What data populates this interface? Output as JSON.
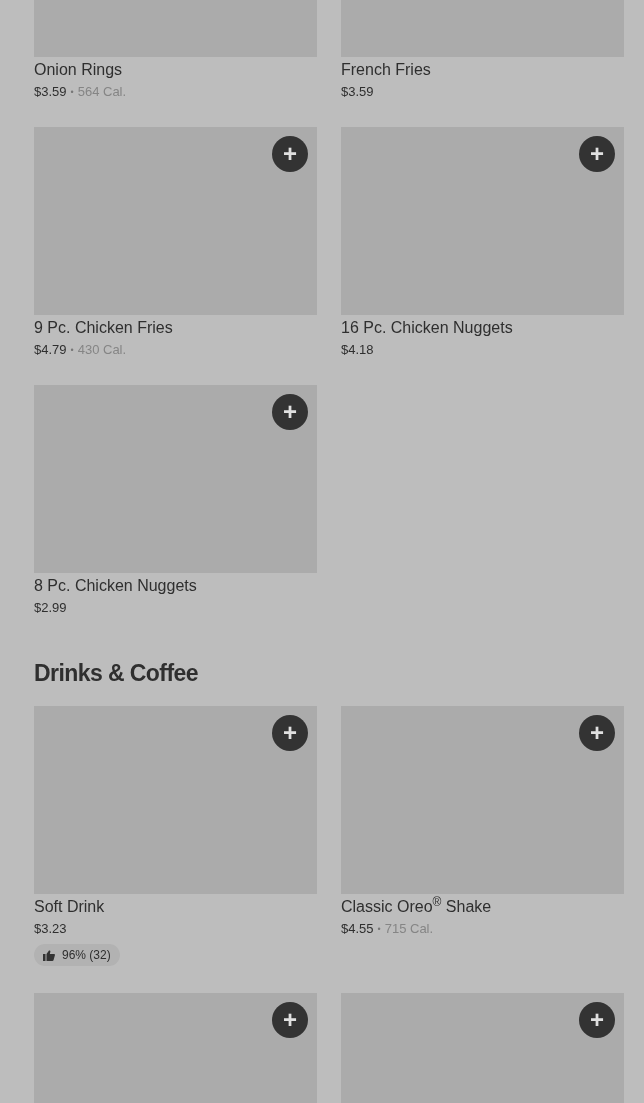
{
  "sections": [
    {
      "items": [
        {
          "name": "Onion Rings",
          "price": "$3.59",
          "separator": "•",
          "calories": "564 Cal."
        },
        {
          "name": "French Fries",
          "price": "$3.59"
        },
        {
          "name": "9 Pc. Chicken Fries",
          "price": "$4.79",
          "separator": "•",
          "calories": "430 Cal.",
          "add_button": "+"
        },
        {
          "name": "16 Pc. Chicken Nuggets",
          "price": "$4.18",
          "add_button": "+"
        },
        {
          "name": "8 Pc. Chicken Nuggets",
          "price": "$2.99",
          "add_button": "+"
        }
      ]
    },
    {
      "title": "Drinks & Coffee",
      "items": [
        {
          "name": "Soft Drink",
          "price": "$3.23",
          "rating": "96% (32)",
          "add_button": "+"
        },
        {
          "name": "Classic Oreo$^{®}$ Shake",
          "price": "$4.55",
          "separator": "•",
          "calories": "715 Cal.",
          "add_button": "+"
        },
        {
          "add_button": "+"
        },
        {
          "add_button": "+"
        }
      ]
    }
  ]
}
